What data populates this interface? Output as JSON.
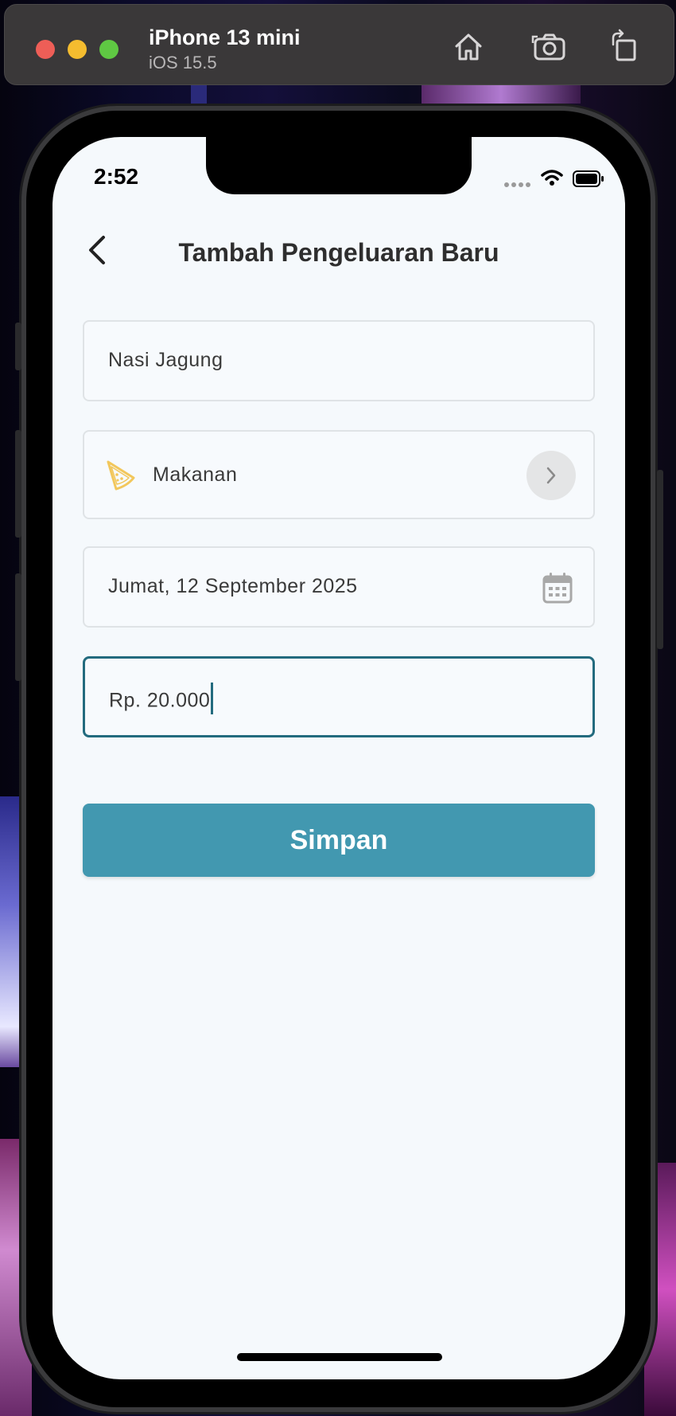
{
  "simulator": {
    "device_name": "iPhone 13 mini",
    "os_version": "iOS 15.5",
    "icons": [
      "home-icon",
      "screenshot-icon",
      "rotate-icon"
    ]
  },
  "status_bar": {
    "time": "2:52",
    "icons": [
      "signal-icon",
      "wifi-icon",
      "battery-icon"
    ]
  },
  "header": {
    "title": "Tambah Pengeluaran Baru",
    "back_icon": "chevron-left-icon"
  },
  "form": {
    "name_value": "Nasi Jagung",
    "category": {
      "label": "Makanan",
      "icon": "pizza-slice-icon",
      "icon_color": "#f2c75c",
      "chevron_icon": "chevron-right-icon"
    },
    "date_value": "Jumat, 12 September 2025",
    "date_icon": "calendar-icon",
    "amount_value": "Rp. 20.000",
    "focus_color": "#236b7e"
  },
  "save_button": {
    "label": "Simpan",
    "color": "#4298b0"
  }
}
